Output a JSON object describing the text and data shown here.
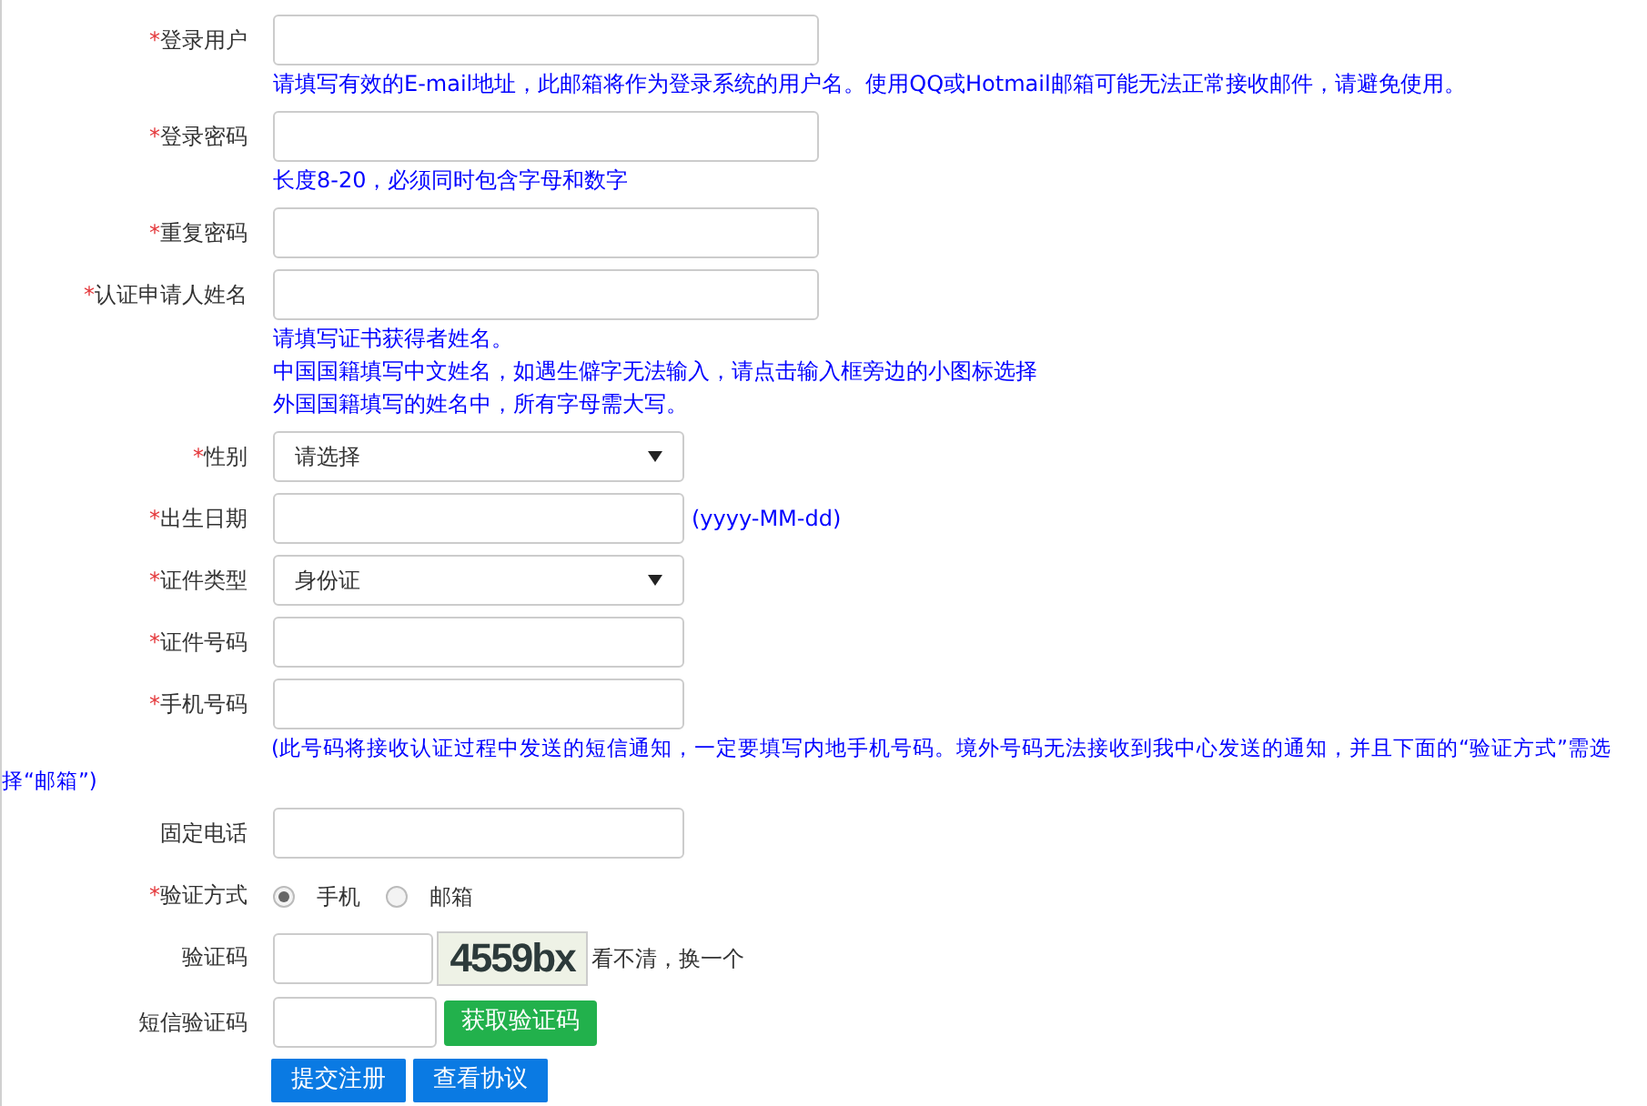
{
  "fields": [
    {
      "kind": "text",
      "label": "登录用户",
      "mark": "*",
      "wide": true,
      "hints": [
        "请填写有效的E-mail地址，此邮箱将作为登录系统的用户名。使用QQ或Hotmail邮箱可能无法正常接收邮件，请避免使用。"
      ]
    },
    {
      "kind": "text",
      "label": "登录密码",
      "mark": "*",
      "wide": true,
      "hints": [
        "长度8-20，必须同时包含字母和数字"
      ]
    },
    {
      "kind": "text",
      "label": "重复密码",
      "mark": "*",
      "wide": true
    },
    {
      "kind": "text",
      "label": "认证申请人姓名",
      "mark": "*",
      "wide": true,
      "hints": [
        "请填写证书获得者姓名。",
        "中国国籍填写中文姓名，如遇生僻字无法输入，请点击输入框旁边的小图标选择",
        "外国国籍填写的姓名中，所有字母需大写。"
      ]
    },
    {
      "kind": "select",
      "label": "性别",
      "mark": "*",
      "value": "请选择"
    },
    {
      "kind": "text",
      "label": "出生日期",
      "mark": "*",
      "wide": false,
      "suffix": "(yyyy-MM-dd)"
    },
    {
      "kind": "select",
      "label": "证件类型",
      "mark": "*",
      "value": "身份证"
    },
    {
      "kind": "text",
      "label": "证件号码",
      "mark": "*",
      "wide": false
    },
    {
      "kind": "text",
      "label": "手机号码",
      "mark": "*",
      "wide": false,
      "note": "(此号码将接收认证过程中发送的短信通知，一定要填写内地手机号码。境外号码无法接收到我中心发送的通知，并且下面的“验证方式”需选择“邮箱”)"
    },
    {
      "kind": "text",
      "label": "固定电话",
      "wide": false
    },
    {
      "kind": "radio",
      "label": "验证方式",
      "mark": "*",
      "options": [
        {
          "label": "手机",
          "selected": true
        },
        {
          "label": "邮箱",
          "selected": false
        }
      ]
    },
    {
      "kind": "captcha",
      "label": "验证码",
      "captcha_text": "4559bx",
      "refresh_link": "看不清，换一个"
    },
    {
      "kind": "sms",
      "label": "短信验证码",
      "button": "获取验证码"
    }
  ],
  "buttons": [
    "提交注册",
    "查看协议"
  ]
}
